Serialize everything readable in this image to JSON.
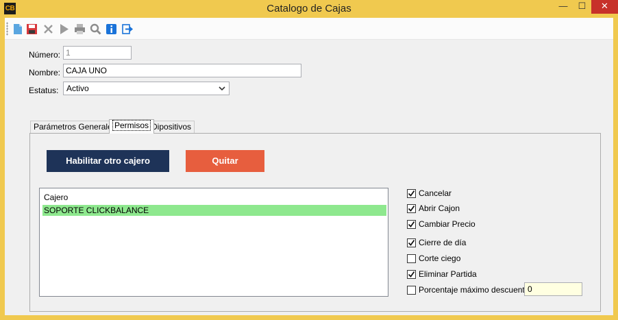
{
  "window": {
    "app_icon": "CB",
    "title": "Catalogo de Cajas",
    "minimize_glyph": "—",
    "maximize_glyph": "☐",
    "close_glyph": "✕"
  },
  "toolbar": {
    "icons": [
      "new-document-icon",
      "save-icon",
      "delete-icon",
      "play-icon",
      "print-icon",
      "search-icon",
      "info-icon",
      "exit-icon"
    ]
  },
  "form": {
    "numero_label": "Número:",
    "numero_value": "1",
    "nombre_label": "Nombre:",
    "nombre_value": "CAJA UNO",
    "estatus_label": "Estatus:",
    "estatus_value": "Activo"
  },
  "tabs": [
    "Parámetros Generales",
    "Permisos",
    "Dipositivos"
  ],
  "active_tab": "Permisos",
  "permisos": {
    "habilitar_label": "Habilitar otro cajero",
    "quitar_label": "Quitar",
    "list_header": "Cajero",
    "cajeros": [
      "SOPORTE CLICKBALANCE"
    ],
    "checks": [
      {
        "label": "Cancelar",
        "checked": true
      },
      {
        "label": "Abrir Cajon",
        "checked": true
      },
      {
        "label": "Cambiar Precio",
        "checked": true
      },
      {
        "label": "Cierre de día",
        "checked": true
      },
      {
        "label": "Corte ciego",
        "checked": false
      },
      {
        "label": "Eliminar Partida",
        "checked": true
      },
      {
        "label": "Porcentaje máximo descuento",
        "checked": false
      }
    ],
    "porcentaje_value": "0"
  },
  "colors": {
    "titlebar": "#f0c94f",
    "primary_button": "#1e3358",
    "danger_button": "#e75e3e",
    "selected_row": "#8ee88e",
    "close_button": "#c7312a"
  }
}
